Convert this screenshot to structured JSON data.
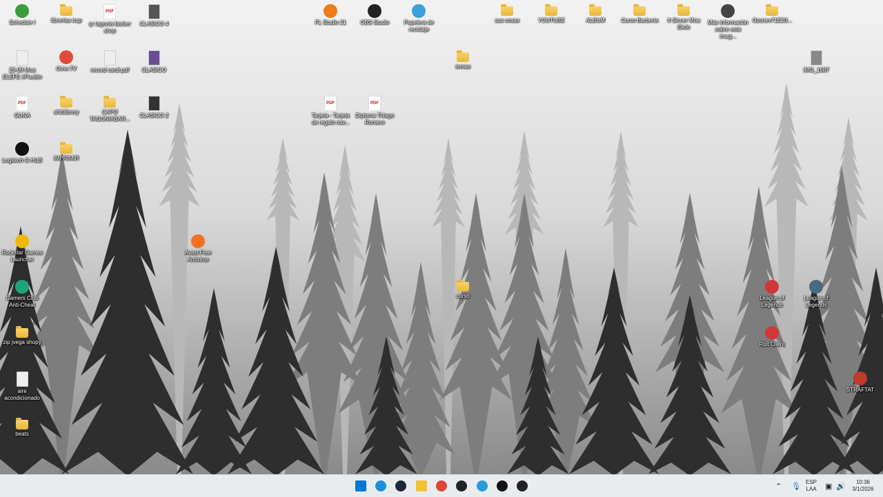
{
  "desktop": {
    "icons": [
      {
        "label": "Schedule I",
        "type": "app",
        "icon": "schedule-icon",
        "color": "#3a9c3a"
      },
      {
        "label": "librerías trap",
        "type": "folder",
        "icon": "folder-icon"
      },
      {
        "label": "qr tagonia barber shop",
        "type": "pdf",
        "icon": "pdf-icon"
      },
      {
        "label": "CLASICO 4",
        "type": "file",
        "icon": "file-icon",
        "color": "#555"
      },
      {
        "label": "FL Studio 21",
        "type": "app",
        "icon": "fl-studio-icon",
        "color": "#f07b1a"
      },
      {
        "label": "OBS Studio",
        "type": "app",
        "icon": "obs-icon",
        "color": "#222"
      },
      {
        "label": "Papelera de reciclaje",
        "type": "app",
        "icon": "recycle-bin-icon",
        "color": "#3aa0d8"
      },
      {
        "label": "sus cosas",
        "type": "folder",
        "icon": "folder-icon"
      },
      {
        "label": "YOUTUBE",
        "type": "folder",
        "icon": "folder-icon"
      },
      {
        "label": "ALBUM",
        "type": "folder",
        "icon": "folder-icon"
      },
      {
        "label": "Curso Barberia",
        "type": "folder",
        "icon": "folder-icon"
      },
      {
        "label": "ft Sincer Moa Elefe",
        "type": "folder",
        "icon": "folder-icon"
      },
      {
        "label": "Más información sobre esta imag...",
        "type": "app",
        "icon": "info-camera-icon",
        "color": "#444"
      },
      {
        "label": "Ozonev71E30...",
        "type": "folder",
        "icon": "folder-icon"
      },
      {
        "label": "25-09 Moa ELÉFE #Pueblo",
        "type": "file",
        "icon": "audio-file-icon",
        "color": "#eee"
      },
      {
        "label": "Ome.TV",
        "type": "app",
        "icon": "ometv-icon",
        "color": "#e24b3b"
      },
      {
        "label": "record cardi.pdf",
        "type": "file",
        "icon": "file-icon",
        "color": "#eee"
      },
      {
        "label": "CLASICO",
        "type": "file",
        "icon": "file-icon",
        "color": "#6a4c93"
      },
      {
        "label": "temas",
        "type": "folder",
        "icon": "folder-icon"
      },
      {
        "label": "IMG_1687",
        "type": "file",
        "icon": "image-file-icon",
        "color": "#888"
      },
      {
        "label": "GUNA",
        "type": "pdf",
        "icon": "pdf-icon"
      },
      {
        "label": "shittlibrery",
        "type": "folder",
        "icon": "folder-icon"
      },
      {
        "label": "CAPO TAGONIABAR...",
        "type": "folder",
        "icon": "folder-icon"
      },
      {
        "label": "CLASICO 2",
        "type": "file",
        "icon": "file-icon",
        "color": "#333"
      },
      {
        "label": "Tarjeta - Tarjeta de regalo nav...",
        "type": "pdf",
        "icon": "pdf-icon"
      },
      {
        "label": "Diploma Thiago Romero",
        "type": "pdf",
        "icon": "pdf-icon"
      },
      {
        "label": "Logitech G HUB",
        "type": "app",
        "icon": "logitech-icon",
        "color": "#111"
      },
      {
        "label": "IMPRIMIR",
        "type": "folder",
        "icon": "folder-icon"
      },
      {
        "label": "Rockstar Games Launcher",
        "type": "app",
        "icon": "rockstar-icon",
        "color": "#f2b705"
      },
      {
        "label": "Avast Free Antivirus",
        "type": "app",
        "icon": "avast-icon",
        "color": "#f37021"
      },
      {
        "label": "Gamers Club Anti-Cheat",
        "type": "app",
        "icon": "gamersclub-icon",
        "color": "#1fa37a"
      },
      {
        "label": "curso",
        "type": "folder",
        "icon": "folder-icon"
      },
      {
        "label": "League of Legends",
        "type": "app",
        "icon": "riot-icon",
        "color": "#d13639"
      },
      {
        "label": "League of Legends",
        "type": "app",
        "icon": "league-icon",
        "color": "#4a6a80"
      },
      {
        "label": "zip jvega shopy",
        "type": "folder",
        "icon": "folder-icon"
      },
      {
        "label": "Riot Client",
        "type": "app",
        "icon": "riot-icon",
        "color": "#d13639"
      },
      {
        "label": "aire acondicionado",
        "type": "file",
        "icon": "file-icon",
        "color": "#eee"
      },
      {
        "label": "STRAFTAT",
        "type": "app",
        "icon": "straftat-icon",
        "color": "#c0392b"
      },
      {
        "label": "beats",
        "type": "folder",
        "icon": "folder-icon"
      }
    ]
  },
  "taskbar": {
    "apps": [
      {
        "name": "start-button",
        "icon": "windows-icon",
        "color": "#0078d4"
      },
      {
        "name": "edge-button",
        "icon": "edge-icon",
        "color": "#1f8fd8"
      },
      {
        "name": "steam-button",
        "icon": "steam-icon",
        "color": "#1b2838"
      },
      {
        "name": "file-explorer-button",
        "icon": "folder-icon",
        "color": "#f1c232"
      },
      {
        "name": "chrome-button",
        "icon": "chrome-icon",
        "color": "#db4437"
      },
      {
        "name": "obs-button",
        "icon": "obs-icon",
        "color": "#222"
      },
      {
        "name": "edge-dev-button",
        "icon": "edge-dev-icon",
        "color": "#2a9bd8"
      },
      {
        "name": "capcut-button",
        "icon": "capcut-icon",
        "color": "#111"
      },
      {
        "name": "epic-games-button",
        "icon": "epic-games-icon",
        "color": "#222"
      }
    ],
    "tray": {
      "lang_top": "ESP",
      "lang_bottom": "LAA",
      "time": "10:36",
      "date": "3/1/2026"
    }
  }
}
